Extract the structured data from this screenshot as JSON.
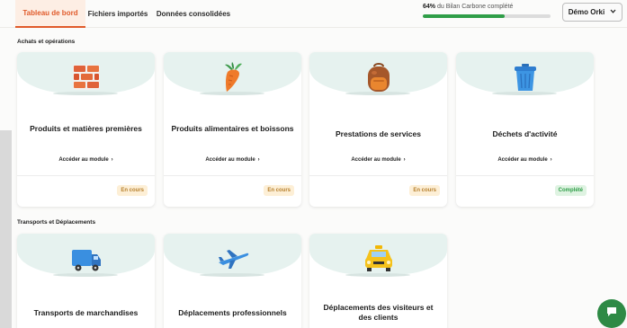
{
  "tabs": [
    {
      "label": "Tableau de bord",
      "active": true
    },
    {
      "label": "Fichiers importés",
      "active": false
    },
    {
      "label": "Données consolidées",
      "active": false
    }
  ],
  "progress": {
    "percent_label": "64%",
    "suffix": "du Bilan Carbone complété",
    "value": 0.64
  },
  "user": {
    "name": "Démo Orki"
  },
  "sections": [
    {
      "title": "Achats et opérations",
      "cards": [
        {
          "title": "Produits et matières premières",
          "icon": "bricks-icon",
          "link": "Accéder au module",
          "status": "En cours"
        },
        {
          "title": "Produits alimentaires et boissons",
          "icon": "carrot-icon",
          "link": "Accéder au module",
          "status": "En cours"
        },
        {
          "title": "Prestations de services",
          "icon": "backpack-icon",
          "link": "Accéder au module",
          "status": "En cours"
        },
        {
          "title": "Déchets d'activité",
          "icon": "trash-bin-icon",
          "link": "Accéder au module",
          "status": "Complété"
        }
      ]
    },
    {
      "title": "Transports et Déplacements",
      "cards": [
        {
          "title": "Transports de marchandises",
          "icon": "truck-icon"
        },
        {
          "title": "Déplacements professionnels",
          "icon": "airplane-icon"
        },
        {
          "title": "Déplacements des visiteurs et des clients",
          "icon": "taxi-icon"
        }
      ]
    }
  ],
  "colors": {
    "accent": "#e05a2a",
    "success": "#2f9e48",
    "card_bg": "#e6f2ef"
  }
}
